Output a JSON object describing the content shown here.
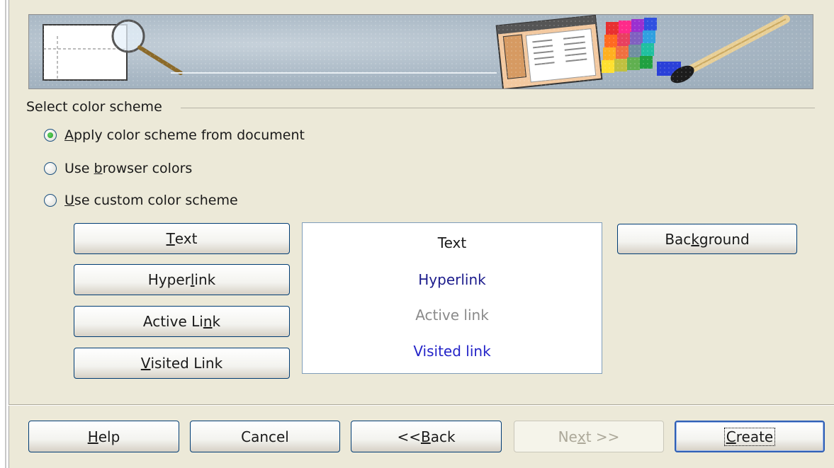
{
  "group": {
    "label": "Select color scheme"
  },
  "options": [
    {
      "before": "",
      "key": "A",
      "after": "pply color scheme from document",
      "selected": true
    },
    {
      "before": "Use ",
      "key": "b",
      "after": "rowser colors",
      "selected": false
    },
    {
      "before": "",
      "key": "U",
      "after": "se custom color scheme",
      "selected": false
    }
  ],
  "color_buttons": {
    "text": {
      "before": "",
      "key": "T",
      "after": "ext"
    },
    "hyperlink": {
      "before": "Hyper",
      "key": "l",
      "after": "ink"
    },
    "active_link": {
      "before": "Active Li",
      "key": "n",
      "after": "k"
    },
    "visited_link": {
      "before": "",
      "key": "V",
      "after": "isited Link"
    },
    "background": {
      "before": "Bac",
      "key": "k",
      "after": "ground"
    }
  },
  "preview": {
    "text": "Text",
    "hyperlink": "Hyperlink",
    "active_link": "Active link",
    "visited_link": "Visited link"
  },
  "colors": {
    "preview_text": "#1a1a1a",
    "preview_hyperlink": "#1c1c8c",
    "preview_active_link": "#8a8a8a",
    "preview_visited_link": "#2323c8"
  },
  "footer": {
    "help": {
      "before": "",
      "key": "H",
      "after": "elp"
    },
    "cancel": "Cancel",
    "back": {
      "before": "<< ",
      "key": "B",
      "after": "ack"
    },
    "next": {
      "before": "Ne",
      "key": "x",
      "after": "t >>",
      "enabled": false
    },
    "create": {
      "before": "",
      "key": "C",
      "after": "reate"
    }
  }
}
